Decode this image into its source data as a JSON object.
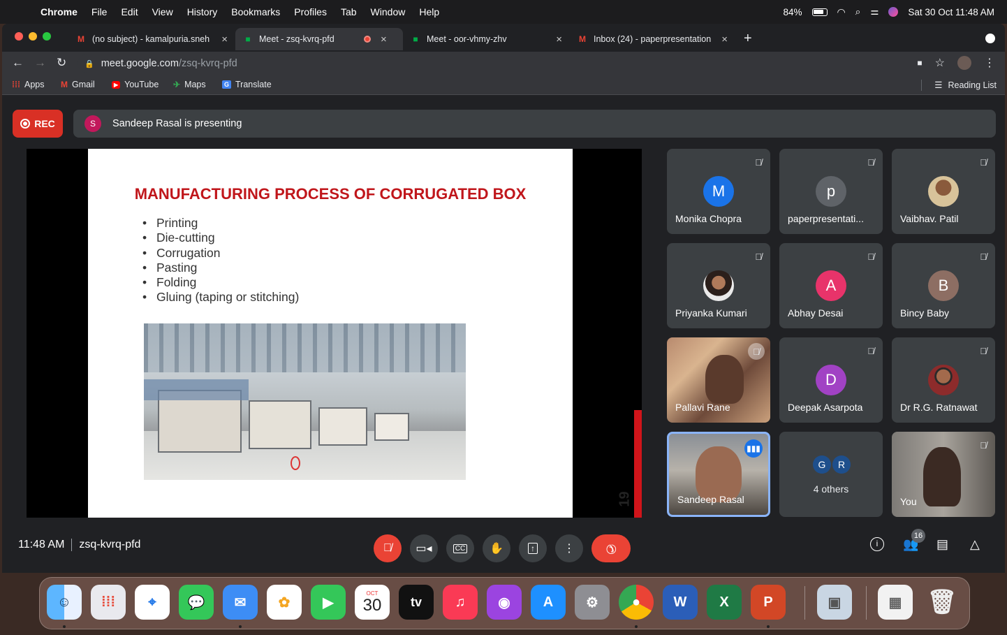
{
  "menubar": {
    "app": "Chrome",
    "items": [
      "File",
      "Edit",
      "View",
      "History",
      "Bookmarks",
      "Profiles",
      "Tab",
      "Window",
      "Help"
    ],
    "battery": "84%",
    "datetime": "Sat 30 Oct  11:48 AM"
  },
  "tabs": [
    {
      "title": "(no subject) - kamalpuria.sneh",
      "icon": "gmail-icon"
    },
    {
      "title": "Meet - zsq-kvrq-pfd",
      "icon": "meet-icon"
    },
    {
      "title": "Meet - oor-vhmy-zhv",
      "icon": "meet-icon"
    },
    {
      "title": "Inbox (24) - paperpresentation",
      "icon": "gmail-icon"
    }
  ],
  "omnibox": {
    "host": "meet.google.com",
    "path": "/zsq-kvrq-pfd"
  },
  "bookmarks": {
    "items": [
      "Apps",
      "Gmail",
      "YouTube",
      "Maps",
      "Translate"
    ],
    "reading_list": "Reading List"
  },
  "meet": {
    "rec_label": "REC",
    "presenter_initial": "S",
    "presenting_text": "Sandeep Rasal is presenting",
    "time": "11:48 AM",
    "code": "zsq-kvrq-pfd",
    "participant_count": "16"
  },
  "slide": {
    "title": "MANUFACTURING PROCESS OF CORRUGATED BOX",
    "bullets": [
      "Printing",
      "Die-cutting",
      "Corrugation",
      "Pasting",
      "Folding",
      "Gluing (taping or stitching)"
    ],
    "page_number": "19"
  },
  "participants": [
    {
      "name": "Monika Chopra",
      "initial": "M",
      "color": "#1a73e8"
    },
    {
      "name": "paperpresentati...",
      "initial": "p",
      "color": "#5f6368"
    },
    {
      "name": "Vaibhav. Patil",
      "initial": "",
      "color": ""
    },
    {
      "name": "Priyanka Kumari",
      "initial": "",
      "color": ""
    },
    {
      "name": "Abhay Desai",
      "initial": "A",
      "color": "#e8336a"
    },
    {
      "name": "Bincy Baby",
      "initial": "B",
      "color": "#8d6e63"
    },
    {
      "name": "Pallavi Rane",
      "initial": "",
      "color": ""
    },
    {
      "name": "Deepak Asarpota",
      "initial": "D",
      "color": "#a142c4"
    },
    {
      "name": "Dr R.G. Ratnawat",
      "initial": "",
      "color": ""
    },
    {
      "name": "Sandeep Rasal",
      "initial": "",
      "color": ""
    },
    {
      "name": "4 others",
      "initial": "",
      "color": ""
    },
    {
      "name": "You",
      "initial": "",
      "color": ""
    }
  ],
  "others": {
    "initials": [
      "G",
      "R"
    ]
  },
  "dock": {
    "calendar_month": "OCT",
    "calendar_day": "30",
    "tv_label": "tv"
  }
}
